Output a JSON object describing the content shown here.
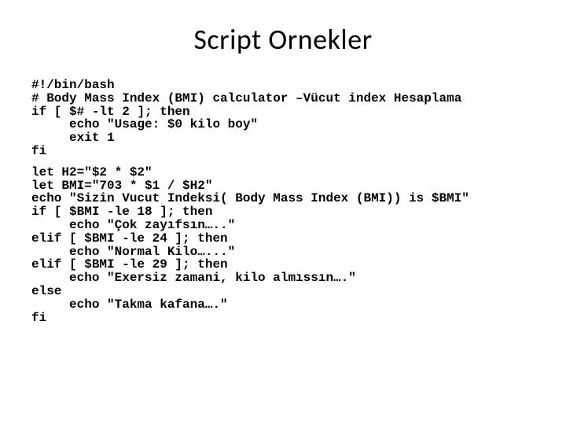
{
  "title": "Script Ornekler",
  "code": {
    "l1": "#!/bin/bash",
    "l2": "# Body Mass Index (BMI) calculator –Vücut index Hesaplama",
    "l3": "if [ $# -lt 2 ]; then",
    "l4": "     echo \"Usage: $0 kilo boy\"",
    "l5": "     exit 1",
    "l6": "fi",
    "l7": "let H2=\"$2 * $2\"",
    "l8": "let BMI=\"703 * $1 / $H2\"",
    "l9": "echo \"Sizin Vucut Indeksi( Body Mass Index (BMI)) is $BMI\"",
    "l10": "if [ $BMI -le 18 ]; then",
    "l11": "     echo \"Çok zayıfsın…..\"",
    "l12": "elif [ $BMI -le 24 ]; then",
    "l13": "     echo \"Normal Kilo…...\"",
    "l14": "elif [ $BMI -le 29 ]; then",
    "l15": "     echo \"Exersiz zamani, kilo almıssın….\"",
    "l16": "else",
    "l17": "     echo \"Takma kafana….\"",
    "l18": "fi"
  }
}
